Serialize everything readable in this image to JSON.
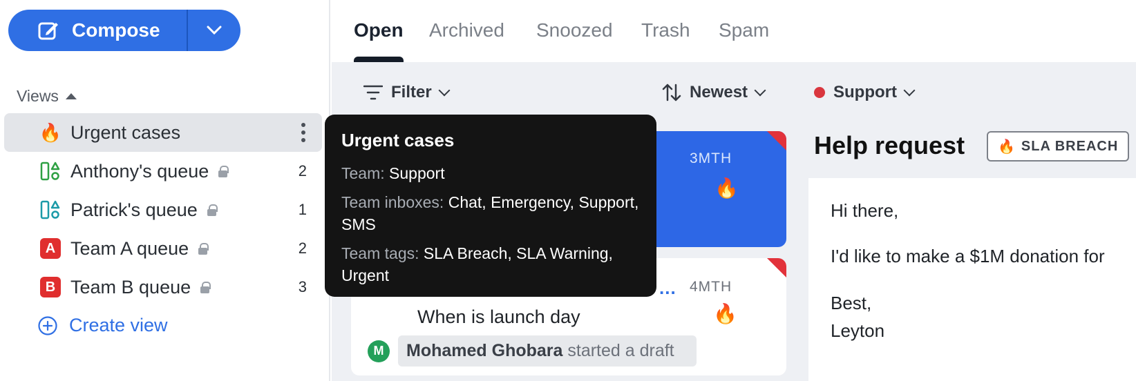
{
  "compose": {
    "label": "Compose"
  },
  "sidebar": {
    "views_heading": "Views",
    "items": [
      {
        "label": "Urgent cases",
        "icon": "flame-icon",
        "locked": false,
        "count": ""
      },
      {
        "label": "Anthony's queue",
        "icon": "queue-icon",
        "locked": true,
        "count": "2"
      },
      {
        "label": "Patrick's queue",
        "icon": "queue-icon",
        "locked": true,
        "count": "1"
      },
      {
        "label": "Team A queue",
        "icon": "letter-a-badge",
        "badge": "A",
        "locked": true,
        "count": "2"
      },
      {
        "label": "Team B queue",
        "icon": "letter-b-badge",
        "badge": "B",
        "locked": true,
        "count": "3"
      }
    ],
    "create_view": "Create view"
  },
  "tabs": [
    "Open",
    "Archived",
    "Snoozed",
    "Trash",
    "Spam"
  ],
  "toolbar": {
    "filter": "Filter",
    "sort": "Newest",
    "team": "Support"
  },
  "cards": [
    {
      "time": "3MTH"
    },
    {
      "time": "4MTH",
      "subject": "When is launch day",
      "avatar_initial": "M",
      "draft_author": "Mohamed Ghobara",
      "draft_text": " started a draft",
      "more": "..."
    }
  ],
  "conversation": {
    "title": "Help request",
    "tag": "SLA BREACH",
    "lines": [
      "Hi there,",
      "I'd like to make a $1M donation for",
      "Best,",
      "Leyton"
    ]
  },
  "tooltip": {
    "title": "Urgent cases",
    "team_key": "Team:",
    "team_val": " Support",
    "inboxes_key": "Team inboxes:",
    "inboxes_val": " Chat, Emergency, Support, SMS",
    "tags_key": "Team tags:",
    "tags_val": " SLA Breach, SLA Warning, Urgent"
  },
  "colors": {
    "accent": "#2f6fe4",
    "danger": "#e2323b",
    "tooltip_bg": "#141414"
  }
}
